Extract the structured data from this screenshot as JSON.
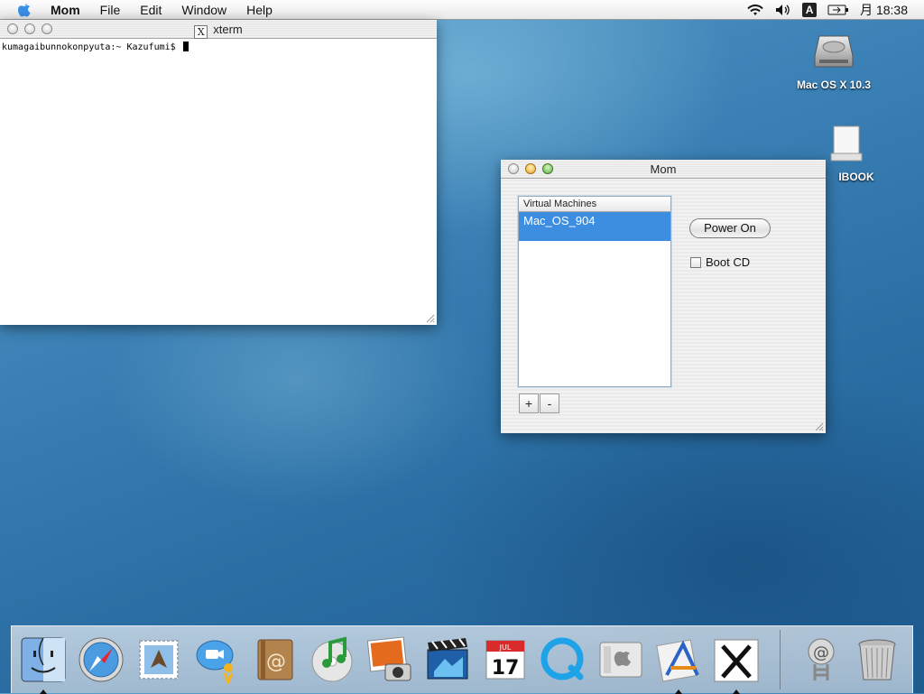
{
  "menubar": {
    "app_name": "Mom",
    "items": [
      "File",
      "Edit",
      "Window",
      "Help"
    ],
    "clock": "月 18:38",
    "input_indicator": "A",
    "status_icons": [
      "wifi-icon",
      "volume-icon",
      "input-method-icon",
      "battery-icon"
    ]
  },
  "xterm": {
    "title": "xterm",
    "prompt": "kumagaibunnokonpyuta:~ Kazufumi$ "
  },
  "mom": {
    "title": "Mom",
    "list_header": "Virtual Machines",
    "vms": [
      "Mac_OS_904"
    ],
    "add_label": "+",
    "remove_label": "-",
    "power_button": "Power On",
    "boot_cd_label": "Boot CD",
    "boot_cd_checked": false
  },
  "desktop": {
    "icons": [
      "Mac OS X 10.3",
      "IBOOK"
    ]
  },
  "dock": {
    "apps": [
      "finder",
      "safari",
      "mail",
      "ichat",
      "address-book",
      "itunes",
      "iphoto",
      "imovie",
      "ical",
      "quicktime",
      "system-preferences",
      "xcode",
      "x11"
    ],
    "running": [
      "finder",
      "xcode",
      "x11"
    ],
    "right": [
      "internet-connect",
      "trash"
    ]
  },
  "colors": {
    "selection": "#3d8ee0",
    "desktop": "#2f78ad"
  }
}
